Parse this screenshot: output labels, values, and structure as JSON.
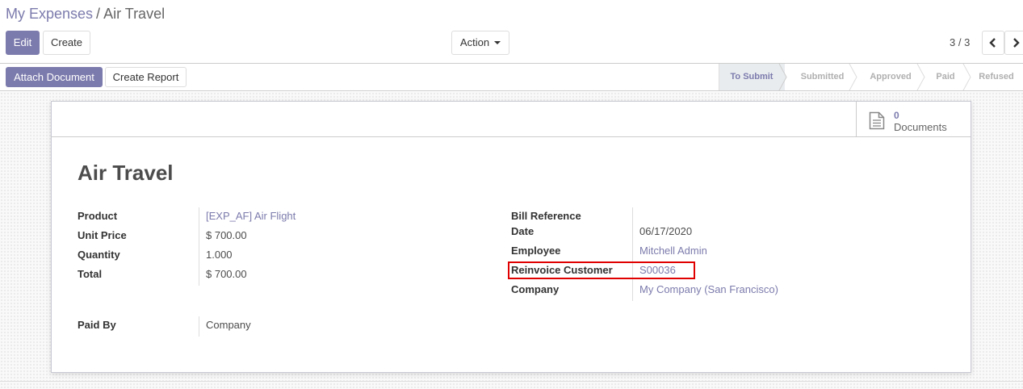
{
  "breadcrumb": {
    "parent": "My Expenses",
    "separator": "/",
    "current": "Air Travel"
  },
  "toolbar": {
    "edit_label": "Edit",
    "create_label": "Create",
    "action_label": "Action"
  },
  "pager": {
    "value": "3 / 3"
  },
  "statusbar": {
    "attach_label": "Attach Document",
    "report_label": "Create Report",
    "steps": [
      "To Submit",
      "Submitted",
      "Approved",
      "Paid",
      "Refused"
    ],
    "active_step": "To Submit"
  },
  "smart_button": {
    "count": "0",
    "label": "Documents",
    "icon": "document-icon"
  },
  "form": {
    "title": "Air Travel",
    "left": {
      "product": {
        "label": "Product",
        "value": "[EXP_AF] Air Flight"
      },
      "unit_price": {
        "label": "Unit Price",
        "value": "$ 700.00"
      },
      "quantity": {
        "label": "Quantity",
        "value": "1.000"
      },
      "total": {
        "label": "Total",
        "value": "$ 700.00"
      },
      "paid_by": {
        "label": "Paid By",
        "value": "Company"
      }
    },
    "right": {
      "bill_reference": {
        "label": "Bill Reference",
        "value": ""
      },
      "date": {
        "label": "Date",
        "value": "06/17/2020"
      },
      "employee": {
        "label": "Employee",
        "value": "Mitchell Admin"
      },
      "reinvoice_customer": {
        "label": "Reinvoice Customer",
        "value": "S00036"
      },
      "company": {
        "label": "Company",
        "value": "My Company (San Francisco)"
      }
    }
  },
  "colors": {
    "brand": "#7c7bad",
    "highlight": "#e00000"
  }
}
